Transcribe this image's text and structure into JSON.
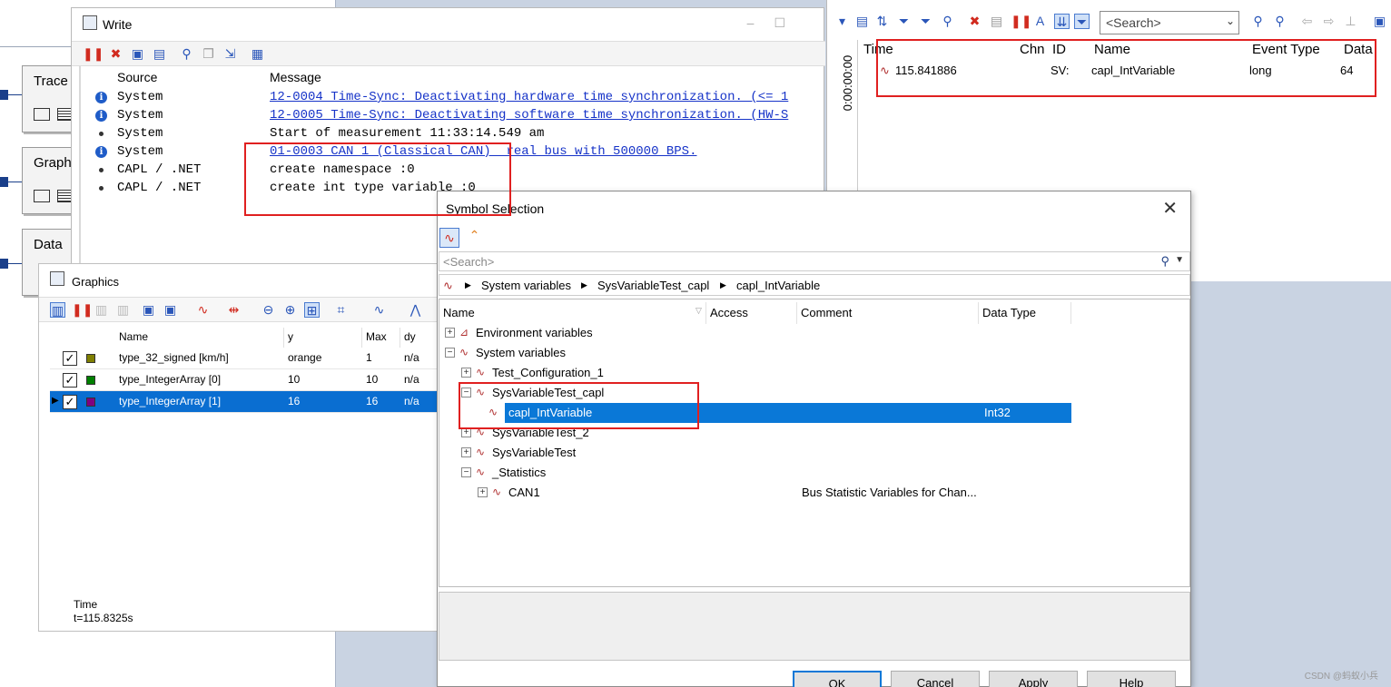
{
  "desktop": {
    "blocks": [
      {
        "label": "Trace"
      },
      {
        "label": "Graphi"
      },
      {
        "label": "Data"
      }
    ]
  },
  "write_window": {
    "title": "Write",
    "columns": {
      "source": "Source",
      "message": "Message"
    },
    "rows": [
      {
        "icon": "info-icon",
        "source": "System",
        "message": "12-0004 Time-Sync: Deactivating hardware time synchronization. (<= 1",
        "link": true
      },
      {
        "icon": "info-icon",
        "source": "System",
        "message": "12-0005 Time-Sync: Deactivating software time synchronization. (HW-S",
        "link": true
      },
      {
        "icon": "bullet-icon",
        "source": "System",
        "message": "Start of measurement 11:33:14.549 am",
        "link": false
      },
      {
        "icon": "info-icon",
        "source": "System",
        "message": "01-0003 CAN 1 (Classical CAN)  real bus with 500000 BPS.",
        "link": true
      },
      {
        "icon": "bullet-icon",
        "source": "CAPL / .NET",
        "message": "create namespace :0",
        "link": false
      },
      {
        "icon": "bullet-icon",
        "source": "CAPL / .NET",
        "message": "create int type variable :0",
        "link": false
      }
    ]
  },
  "trace_window": {
    "search_placeholder": "<Search>",
    "side_time": "0:00:00:00",
    "columns": {
      "time": "Time",
      "chn": "Chn",
      "id": "ID",
      "name": "Name",
      "event_type": "Event Type",
      "data": "Data"
    },
    "row": {
      "time": "115.841886",
      "chn": "",
      "id": "SV:",
      "name": "capl_IntVariable",
      "event_type": "long",
      "data": "64"
    }
  },
  "graphics_window": {
    "title": "Graphics",
    "columns": {
      "name": "Name",
      "y": "y",
      "max": "Max",
      "dy": "dy"
    },
    "signals": [
      {
        "name": "type_32_signed [km/h]",
        "y": "orange",
        "max": "1",
        "dy": "n/a",
        "color": "#7f7f00",
        "checked": true,
        "selected": false
      },
      {
        "name": "type_IntegerArray [0]",
        "y": "10",
        "max": "10",
        "dy": "n/a",
        "color": "#008000",
        "checked": true,
        "selected": false
      },
      {
        "name": "type_IntegerArray [1]",
        "y": "16",
        "max": "16",
        "dy": "n/a",
        "color": "#800080",
        "checked": true,
        "selected": true
      }
    ],
    "time_label": "Time",
    "time_value": "t=115.8325s"
  },
  "symbol_dialog": {
    "title": "Symbol Selection",
    "search_placeholder": "<Search>",
    "breadcrumb": [
      "System variables",
      "SysVariableTest_capl",
      "capl_IntVariable"
    ],
    "columns": {
      "name": "Name",
      "access": "Access",
      "comment": "Comment",
      "data_type": "Data Type"
    },
    "tree": [
      {
        "label": "Environment variables",
        "level": 0,
        "expander": "+",
        "comment": "",
        "data_type": "",
        "selected": false
      },
      {
        "label": "System variables",
        "level": 0,
        "expander": "-",
        "comment": "",
        "data_type": "",
        "selected": false
      },
      {
        "label": "Test_Configuration_1",
        "level": 1,
        "expander": "+",
        "comment": "",
        "data_type": "",
        "selected": false
      },
      {
        "label": "SysVariableTest_capl",
        "level": 1,
        "expander": "-",
        "comment": "",
        "data_type": "",
        "selected": false
      },
      {
        "label": "capl_IntVariable",
        "level": 2,
        "expander": "",
        "comment": "",
        "data_type": "Int32",
        "selected": true
      },
      {
        "label": "SysVariableTest_2",
        "level": 1,
        "expander": "+",
        "comment": "",
        "data_type": "",
        "selected": false
      },
      {
        "label": "SysVariableTest",
        "level": 1,
        "expander": "+",
        "comment": "",
        "data_type": "",
        "selected": false
      },
      {
        "label": "_Statistics",
        "level": 1,
        "expander": "-",
        "comment": "",
        "data_type": "",
        "selected": false
      },
      {
        "label": "CAN1",
        "level": 2,
        "expander": "+",
        "comment": "Bus Statistic Variables for Chan...",
        "data_type": "",
        "selected": false
      }
    ],
    "buttons": {
      "ok": "OK",
      "cancel": "Cancel",
      "apply": "Apply",
      "help": "Help"
    }
  },
  "watermark": "CSDN @蚂蚁小兵",
  "colors": {
    "highlight_box": "#e02020",
    "selection": "#0a78d7",
    "link": "#1633c8"
  }
}
